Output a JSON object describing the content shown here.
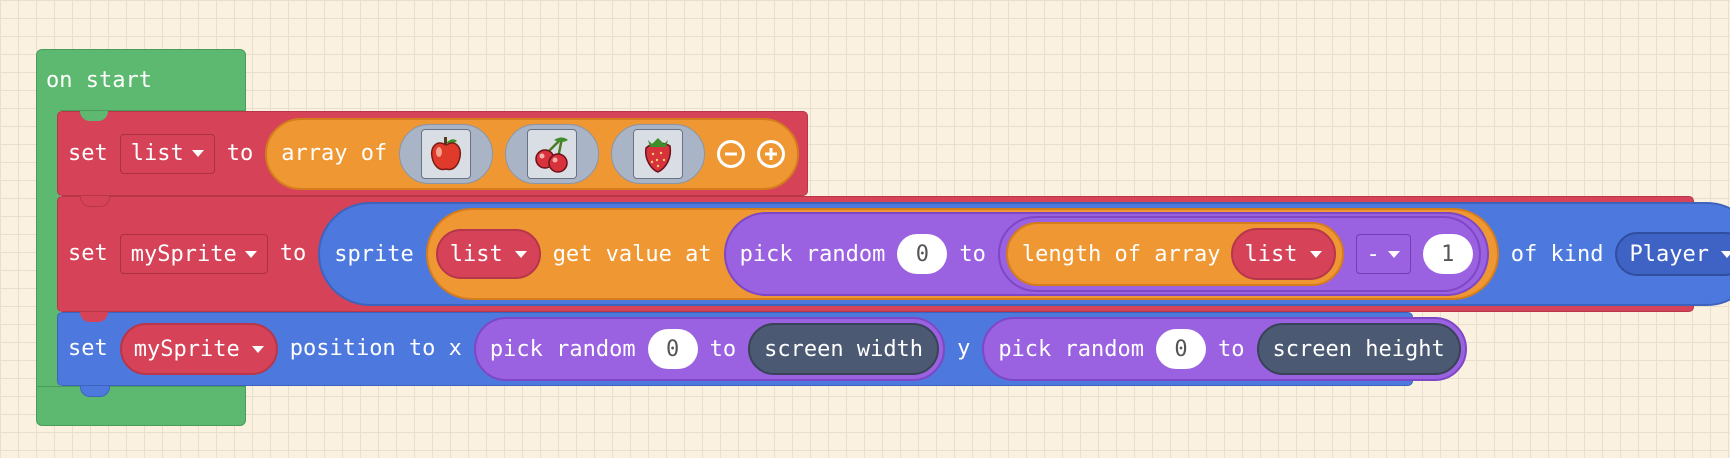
{
  "event": {
    "label": "on start"
  },
  "stmt1": {
    "set": "set",
    "var": "list",
    "to": "to",
    "array_of": "array of",
    "images": [
      "apple-icon",
      "cherries-icon",
      "strawberry-icon"
    ],
    "remove": "remove-item-icon",
    "add": "add-item-icon"
  },
  "stmt2": {
    "set": "set",
    "var": "mySprite",
    "to": "to",
    "sprite": "sprite",
    "list_var": "list",
    "get_value_at": "get value at",
    "pick_random": "pick random",
    "min": "0",
    "to2": "to",
    "length_of_array": "length of array",
    "list_var2": "list",
    "op": "-",
    "one": "1",
    "of_kind": "of kind",
    "kind": "Player"
  },
  "stmt3": {
    "set": "set",
    "var": "mySprite",
    "position_to_x": "position to x",
    "pick_random_x": "pick random",
    "min_x": "0",
    "to_x": "to",
    "screen_width": "screen width",
    "y": "y",
    "pick_random_y": "pick random",
    "min_y": "0",
    "to_y": "to",
    "screen_height": "screen height"
  },
  "colors": {
    "event": "#5cb96f",
    "variables": "#d64358",
    "arrays": "#ef9732",
    "sprites": "#4d79de",
    "math": "#9a61e0",
    "scene": "#4b5a72",
    "background": "#fbf1e0"
  }
}
